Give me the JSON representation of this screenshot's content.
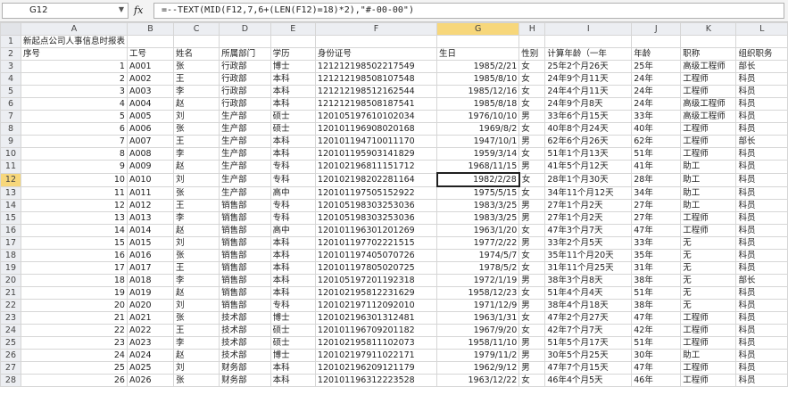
{
  "namebox": {
    "value": "G12"
  },
  "formula": {
    "fx_symbol": "fx",
    "text": "=--TEXT(MID(F12,7,6+(LEN(F12)=18)*2),\"#-00-00\")"
  },
  "columns": [
    "A",
    "B",
    "C",
    "D",
    "E",
    "F",
    "G",
    "H",
    "I",
    "J",
    "K",
    "L"
  ],
  "selected_column": "G",
  "selected_row": "12",
  "title": "新起点公司人事信息时报表",
  "headers": [
    "序号",
    "工号",
    "姓名",
    "所属部门",
    "学历",
    "身份证号",
    "生日",
    "性别",
    "计算年龄（一年",
    "年龄",
    "职称",
    "组织职务"
  ],
  "rows": [
    [
      "1",
      "A001",
      "张",
      "行政部",
      "博士",
      "121212198502217549",
      "1985/2/21",
      "女",
      "25年2个月26天",
      "25年",
      "高级工程师",
      "部长"
    ],
    [
      "2",
      "A002",
      "王",
      "行政部",
      "本科",
      "121212198508107548",
      "1985/8/10",
      "女",
      "24年9个月11天",
      "24年",
      "工程师",
      "科员"
    ],
    [
      "3",
      "A003",
      "李",
      "行政部",
      "本科",
      "121212198512162544",
      "1985/12/16",
      "女",
      "24年4个月11天",
      "24年",
      "工程师",
      "科员"
    ],
    [
      "4",
      "A004",
      "赵",
      "行政部",
      "本科",
      "121212198508187541",
      "1985/8/18",
      "女",
      "24年9个月8天",
      "24年",
      "高级工程师",
      "科员"
    ],
    [
      "5",
      "A005",
      "刘",
      "生产部",
      "硕士",
      "120105197610102034",
      "1976/10/10",
      "男",
      "33年6个月15天",
      "33年",
      "高级工程师",
      "科员"
    ],
    [
      "6",
      "A006",
      "张",
      "生产部",
      "硕士",
      "120101196908020168",
      "1969/8/2",
      "女",
      "40年8个月24天",
      "40年",
      "工程师",
      "科员"
    ],
    [
      "7",
      "A007",
      "王",
      "生产部",
      "本科",
      "120101194710011170",
      "1947/10/1",
      "男",
      "62年6个月26天",
      "62年",
      "工程师",
      "部长"
    ],
    [
      "8",
      "A008",
      "李",
      "生产部",
      "本科",
      "120101195903141829",
      "1959/3/14",
      "女",
      "51年1个月13天",
      "51年",
      "工程师",
      "科员"
    ],
    [
      "9",
      "A009",
      "赵",
      "生产部",
      "专科",
      "120102196811151712",
      "1968/11/15",
      "男",
      "41年5个月12天",
      "41年",
      "助工",
      "科员"
    ],
    [
      "10",
      "A010",
      "刘",
      "生产部",
      "专科",
      "120102198202281164",
      "1982/2/28",
      "女",
      "28年1个月30天",
      "28年",
      "助工",
      "科员"
    ],
    [
      "11",
      "A011",
      "张",
      "生产部",
      "高中",
      "120101197505152922",
      "1975/5/15",
      "女",
      "34年11个月12天",
      "34年",
      "助工",
      "科员"
    ],
    [
      "12",
      "A012",
      "王",
      "销售部",
      "专科",
      "120105198303253036",
      "1983/3/25",
      "男",
      "27年1个月2天",
      "27年",
      "助工",
      "科员"
    ],
    [
      "13",
      "A013",
      "李",
      "销售部",
      "专科",
      "120105198303253036",
      "1983/3/25",
      "男",
      "27年1个月2天",
      "27年",
      "工程师",
      "科员"
    ],
    [
      "14",
      "A014",
      "赵",
      "销售部",
      "高中",
      "120101196301201269",
      "1963/1/20",
      "女",
      "47年3个月7天",
      "47年",
      "工程师",
      "科员"
    ],
    [
      "15",
      "A015",
      "刘",
      "销售部",
      "本科",
      "120101197702221515",
      "1977/2/22",
      "男",
      "33年2个月5天",
      "33年",
      "无",
      "科员"
    ],
    [
      "16",
      "A016",
      "张",
      "销售部",
      "本科",
      "120101197405070726",
      "1974/5/7",
      "女",
      "35年11个月20天",
      "35年",
      "无",
      "科员"
    ],
    [
      "17",
      "A017",
      "王",
      "销售部",
      "本科",
      "120101197805020725",
      "1978/5/2",
      "女",
      "31年11个月25天",
      "31年",
      "无",
      "科员"
    ],
    [
      "18",
      "A018",
      "李",
      "销售部",
      "本科",
      "120105197201192318",
      "1972/1/19",
      "男",
      "38年3个月8天",
      "38年",
      "无",
      "部长"
    ],
    [
      "19",
      "A019",
      "赵",
      "销售部",
      "本科",
      "120102195812231629",
      "1958/12/23",
      "女",
      "51年4个月4天",
      "51年",
      "无",
      "科员"
    ],
    [
      "20",
      "A020",
      "刘",
      "销售部",
      "专科",
      "120102197112092010",
      "1971/12/9",
      "男",
      "38年4个月18天",
      "38年",
      "无",
      "科员"
    ],
    [
      "21",
      "A021",
      "张",
      "技术部",
      "博士",
      "120102196301312481",
      "1963/1/31",
      "女",
      "47年2个月27天",
      "47年",
      "工程师",
      "科员"
    ],
    [
      "22",
      "A022",
      "王",
      "技术部",
      "硕士",
      "120101196709201182",
      "1967/9/20",
      "女",
      "42年7个月7天",
      "42年",
      "工程师",
      "科员"
    ],
    [
      "23",
      "A023",
      "李",
      "技术部",
      "硕士",
      "120102195811102073",
      "1958/11/10",
      "男",
      "51年5个月17天",
      "51年",
      "工程师",
      "科员"
    ],
    [
      "24",
      "A024",
      "赵",
      "技术部",
      "博士",
      "120102197911022171",
      "1979/11/2",
      "男",
      "30年5个月25天",
      "30年",
      "助工",
      "科员"
    ],
    [
      "25",
      "A025",
      "刘",
      "财务部",
      "本科",
      "120102196209121179",
      "1962/9/12",
      "男",
      "47年7个月15天",
      "47年",
      "工程师",
      "科员"
    ],
    [
      "26",
      "A026",
      "张",
      "财务部",
      "本科",
      "120101196312223528",
      "1963/12/22",
      "女",
      "46年4个月5天",
      "46年",
      "工程师",
      "科员"
    ]
  ]
}
